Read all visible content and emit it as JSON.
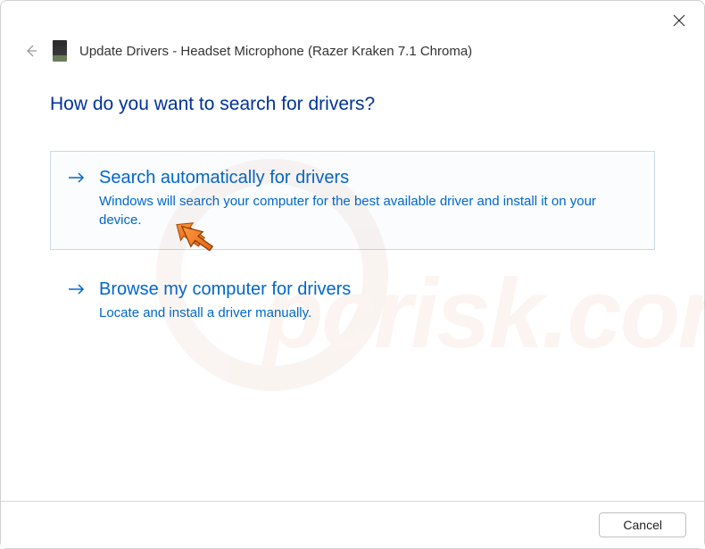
{
  "window_title": "Update Drivers - Headset Microphone (Razer Kraken 7.1 Chroma)",
  "heading": "How do you want to search for drivers?",
  "options": [
    {
      "title": "Search automatically for drivers",
      "description": "Windows will search your computer for the best available driver and install it on your device."
    },
    {
      "title": "Browse my computer for drivers",
      "description": "Locate and install a driver manually."
    }
  ],
  "footer": {
    "cancel_label": "Cancel"
  },
  "watermark": "pcrisk.com"
}
